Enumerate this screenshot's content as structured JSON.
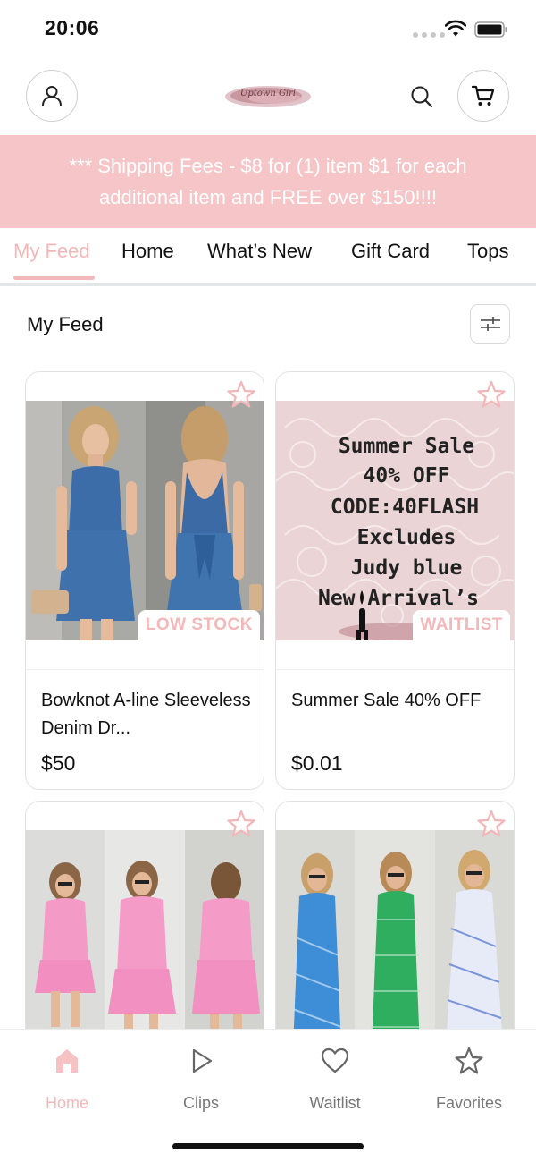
{
  "status_bar": {
    "time": "20:06"
  },
  "header": {
    "logo_text": "Uptown Girl",
    "account_icon": "user-icon",
    "search_icon": "search-icon",
    "cart_icon": "cart-icon"
  },
  "banner": {
    "text": "*** Shipping Fees - $8 for (1) item $1 for each additional item and FREE over $150!!!!"
  },
  "tabs": [
    {
      "label": "My Feed",
      "active": true
    },
    {
      "label": "Home"
    },
    {
      "label": "What’s New"
    },
    {
      "label": "Gift Card"
    },
    {
      "label": "Tops"
    }
  ],
  "section": {
    "title": "My Feed",
    "filter_icon": "sliders-icon"
  },
  "products": [
    {
      "name": "Bowknot A-line Sleeveless Denim Dr...",
      "price": "$50",
      "badge": "LOW STOCK"
    },
    {
      "name": "Summer Sale 40% OFF",
      "price": "$0.01",
      "badge": "WAITLIST",
      "image_text": [
        "Summer Sale",
        "40% OFF",
        "CODE:40FLASH",
        "Excludes",
        "Judy blue",
        "New Arrival’s"
      ]
    },
    {
      "name": "",
      "price": "",
      "badge": ""
    },
    {
      "name": "",
      "price": "",
      "badge": ""
    }
  ],
  "bottom_nav": [
    {
      "label": "Home",
      "icon": "home-icon",
      "active": true
    },
    {
      "label": "Clips",
      "icon": "play-icon"
    },
    {
      "label": "Waitlist",
      "icon": "heart-icon"
    },
    {
      "label": "Favorites",
      "icon": "star-icon"
    }
  ],
  "colors": {
    "accent_pink": "#f6c5c7",
    "active_tab": "#f4b7b8",
    "badge_text": "#f3b8b9"
  }
}
